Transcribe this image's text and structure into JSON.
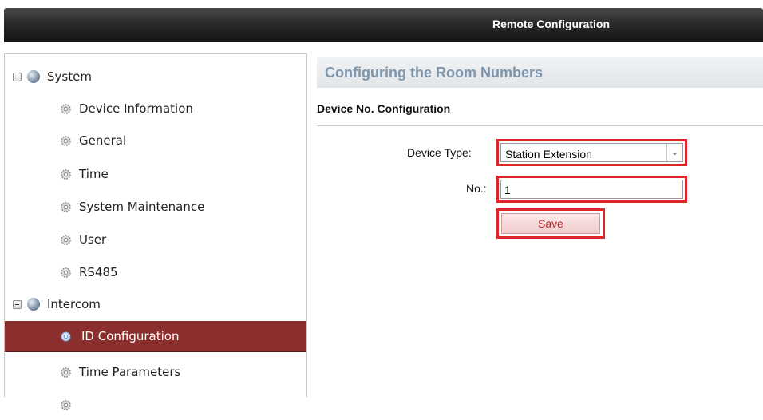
{
  "window": {
    "title": "Remote Configuration"
  },
  "sidebar": {
    "groups": [
      {
        "label": "System",
        "icon": "globe-icon"
      },
      {
        "label": "Intercom",
        "icon": "globe-icon"
      }
    ],
    "system_items": [
      "Device Information",
      "General",
      "Time",
      "System Maintenance",
      "User",
      "RS485"
    ],
    "intercom_items": [
      "ID Configuration",
      "Time Parameters"
    ],
    "selected": "ID Configuration"
  },
  "main": {
    "header": "Configuring the Room Numbers",
    "section": "Device No. Configuration",
    "device_type_label": "Device Type:",
    "device_type_value": "Station Extension",
    "no_label": "No.:",
    "no_value": "1",
    "save_label": "Save"
  },
  "colors": {
    "selected_bg": "#8b2e2e",
    "highlight_border": "#e0242b",
    "header_text": "#7d96ad"
  }
}
